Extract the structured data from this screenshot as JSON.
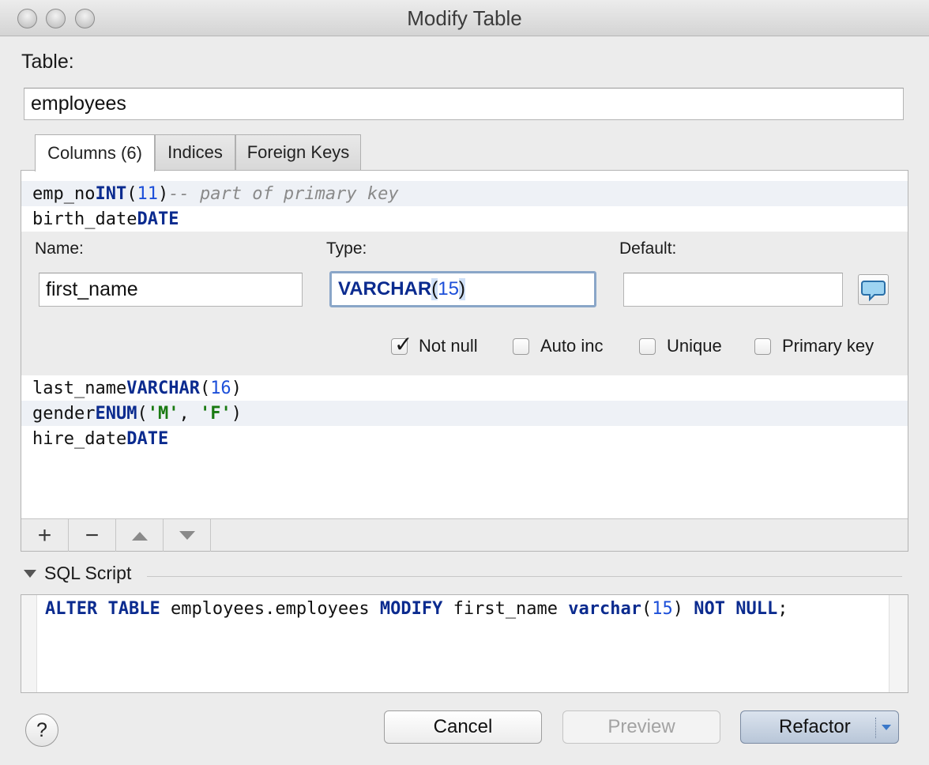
{
  "window": {
    "title": "Modify Table"
  },
  "table": {
    "label": "Table:",
    "value": "employees"
  },
  "tabs": [
    {
      "label": "Columns (6)",
      "active": true
    },
    {
      "label": "Indices",
      "active": false
    },
    {
      "label": "Foreign Keys",
      "active": false
    }
  ],
  "columns_before": [
    {
      "name": "emp_no",
      "type": "INT",
      "open": "(",
      "arg": "11",
      "close": ")",
      "comment": "-- part of primary key"
    },
    {
      "name": "birth_date",
      "type": "DATE"
    }
  ],
  "editor": {
    "name_label": "Name:",
    "name_value": "first_name",
    "type_label": "Type:",
    "type_keyword": "VARCHAR",
    "type_open": "(",
    "type_arg": "15",
    "type_close": ")",
    "default_label": "Default:",
    "default_value": "",
    "comment_icon": "speech-bubble-icon",
    "checkboxes": [
      {
        "label": "Not null",
        "checked": true
      },
      {
        "label": "Auto inc",
        "checked": false
      },
      {
        "label": "Unique",
        "checked": false
      },
      {
        "label": "Primary key",
        "checked": false
      }
    ]
  },
  "columns_after": [
    {
      "name": "last_name",
      "type": "VARCHAR",
      "open": "(",
      "arg": "16",
      "close": ")"
    },
    {
      "name": "gender",
      "type": "ENUM",
      "open": "(",
      "s1": "'M'",
      "sep": ", ",
      "s2": "'F'",
      "close": ")"
    },
    {
      "name": "hire_date",
      "type": "DATE"
    }
  ],
  "toolbar": {
    "add": "+",
    "remove": "−",
    "up_icon": "arrow-up-icon",
    "down_icon": "arrow-down-icon"
  },
  "sql": {
    "section_label": "SQL Script",
    "kw1": "ALTER TABLE",
    "t1": " employees.employees ",
    "kw2": "MODIFY",
    "t2": " first_name ",
    "kw3": "varchar",
    "t3": "(",
    "n1": "15",
    "t4": ") ",
    "kw4": "NOT NULL",
    "t5": ";"
  },
  "buttons": {
    "help": "?",
    "cancel": "Cancel",
    "preview": "Preview",
    "refactor": "Refactor"
  }
}
